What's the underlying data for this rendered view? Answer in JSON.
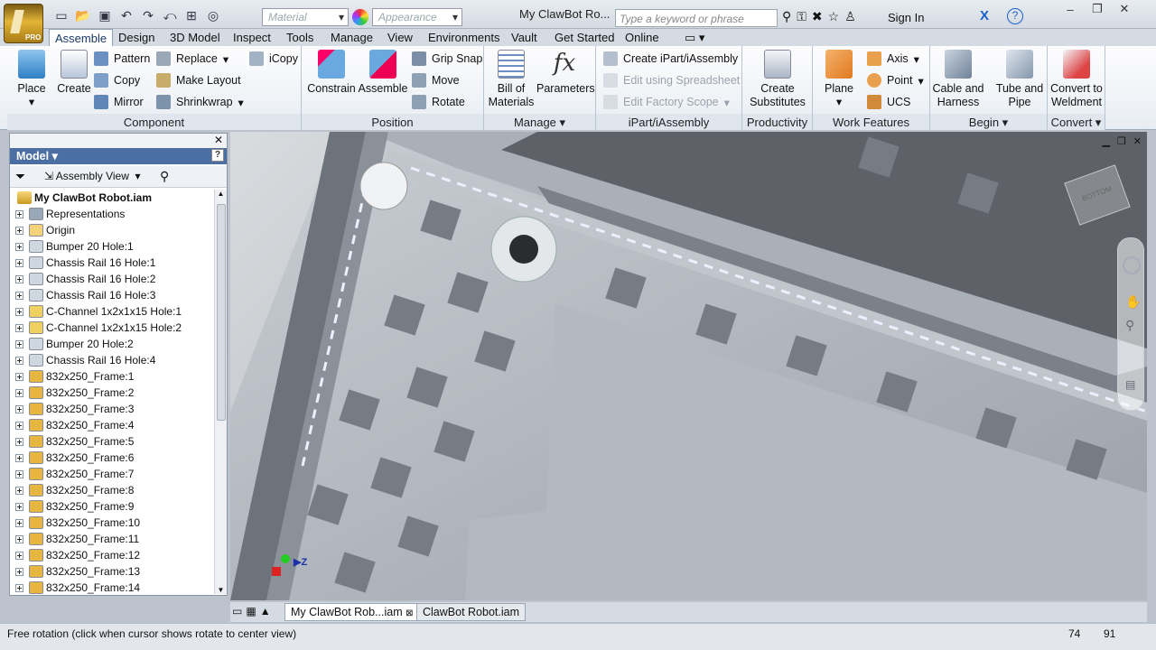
{
  "app": {
    "edition": "PRO",
    "document_title": "My ClawBot Ro...",
    "search_placeholder": "Type a keyword or phrase",
    "sign_in": "Sign In"
  },
  "qat": {
    "material": "Material",
    "appearance": "Appearance"
  },
  "tabs": [
    "Assemble",
    "Design",
    "3D Model",
    "Inspect",
    "Tools",
    "Manage",
    "View",
    "Environments",
    "Vault",
    "Get Started",
    "Online"
  ],
  "ribbon": {
    "component": {
      "title": "Component",
      "place": "Place",
      "create": "Create",
      "pattern": "Pattern",
      "copy": "Copy",
      "mirror": "Mirror",
      "replace": "Replace",
      "make_layout": "Make Layout",
      "shrinkwrap": "Shrinkwrap",
      "icopy": "iCopy"
    },
    "position": {
      "title": "Position",
      "constrain": "Constrain",
      "assemble": "Assemble",
      "grip_snap": "Grip Snap",
      "move": "Move",
      "rotate": "Rotate"
    },
    "manage": {
      "title": "Manage",
      "bom": "Bill of Materials",
      "parameters": "Parameters"
    },
    "ipart": {
      "title": "iPart/iAssembly",
      "create": "Create iPart/iAssembly",
      "edit_ss": "Edit using Spreadsheet",
      "edit_scope": "Edit Factory Scope"
    },
    "productivity": {
      "title": "Productivity",
      "create_subs": "Create Substitutes"
    },
    "work": {
      "title": "Work Features",
      "plane": "Plane",
      "axis": "Axis",
      "point": "Point",
      "ucs": "UCS"
    },
    "begin": {
      "title": "Begin",
      "cable": "Cable and Harness",
      "tube": "Tube and Pipe"
    },
    "convert": {
      "title": "Convert",
      "weldment": "Convert to Weldment"
    }
  },
  "browser": {
    "title": "Model",
    "view": "Assembly View",
    "root": "My ClawBot Robot.iam",
    "items": [
      {
        "label": "Representations",
        "icon": "representations-icon"
      },
      {
        "label": "Origin",
        "icon": "folder-icon"
      },
      {
        "label": "Bumper 20 Hole:1",
        "icon": "sheetmetal-icon"
      },
      {
        "label": "Chassis Rail 16 Hole:1",
        "icon": "sheetmetal-icon"
      },
      {
        "label": "Chassis Rail 16 Hole:2",
        "icon": "sheetmetal-icon"
      },
      {
        "label": "Chassis Rail 16 Hole:3",
        "icon": "sheetmetal-icon"
      },
      {
        "label": "C-Channel 1x2x1x15 Hole:1",
        "icon": "part-icon"
      },
      {
        "label": "C-Channel 1x2x1x15 Hole:2",
        "icon": "part-icon"
      },
      {
        "label": "Bumper 20 Hole:2",
        "icon": "sheetmetal-icon"
      },
      {
        "label": "Chassis Rail 16 Hole:4",
        "icon": "sheetmetal-icon"
      },
      {
        "label": "832x250_Frame:1",
        "icon": "subassembly-icon"
      },
      {
        "label": "832x250_Frame:2",
        "icon": "subassembly-icon"
      },
      {
        "label": "832x250_Frame:3",
        "icon": "subassembly-icon"
      },
      {
        "label": "832x250_Frame:4",
        "icon": "subassembly-icon"
      },
      {
        "label": "832x250_Frame:5",
        "icon": "subassembly-icon"
      },
      {
        "label": "832x250_Frame:6",
        "icon": "subassembly-icon"
      },
      {
        "label": "832x250_Frame:7",
        "icon": "subassembly-icon"
      },
      {
        "label": "832x250_Frame:8",
        "icon": "subassembly-icon"
      },
      {
        "label": "832x250_Frame:9",
        "icon": "subassembly-icon"
      },
      {
        "label": "832x250_Frame:10",
        "icon": "subassembly-icon"
      },
      {
        "label": "832x250_Frame:11",
        "icon": "subassembly-icon"
      },
      {
        "label": "832x250_Frame:12",
        "icon": "subassembly-icon"
      },
      {
        "label": "832x250_Frame:13",
        "icon": "subassembly-icon"
      },
      {
        "label": "832x250_Frame:14",
        "icon": "subassembly-icon"
      }
    ]
  },
  "viewcube": {
    "label": "BOTTOM"
  },
  "doc_tabs": [
    "My ClawBot Rob...iam",
    "ClawBot Robot.iam"
  ],
  "status": {
    "message": "Free rotation (click when cursor shows rotate to center view)",
    "count1": "74",
    "count2": "91"
  },
  "colors": {
    "ribbon_tab_active": "#ffffff",
    "browser_header": "#4c6fa3",
    "app_button": "#d4a42c"
  }
}
